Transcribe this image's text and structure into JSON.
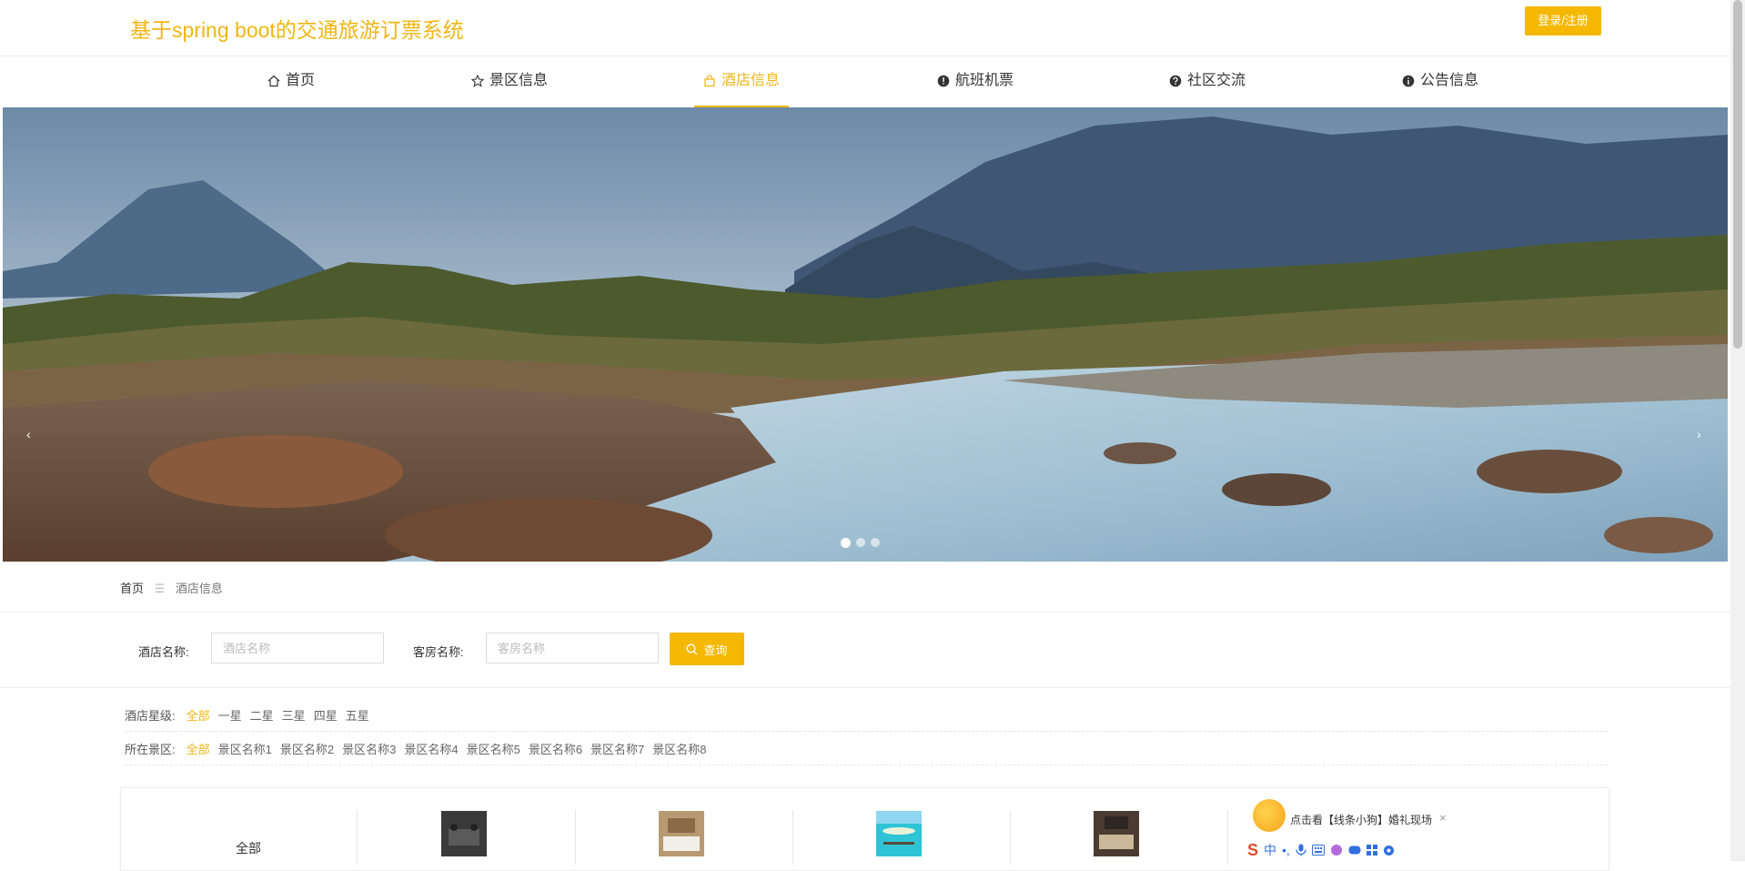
{
  "header": {
    "title": "基于spring boot的交通旅游订票系统",
    "login_label": "登录/注册"
  },
  "nav": {
    "items": [
      {
        "label": "首页",
        "icon": "home-icon"
      },
      {
        "label": "景区信息",
        "icon": "star-icon"
      },
      {
        "label": "酒店信息",
        "icon": "bag-icon"
      },
      {
        "label": "航班机票",
        "icon": "alert-icon"
      },
      {
        "label": "社区交流",
        "icon": "question-icon"
      },
      {
        "label": "公告信息",
        "icon": "info-icon"
      }
    ],
    "active_index": 2
  },
  "banner": {
    "slide_count": 3,
    "active_slide": 1,
    "prev_glyph": "‹",
    "next_glyph": "›"
  },
  "breadcrumb": {
    "home": "首页",
    "separator": "☰",
    "current": "酒店信息"
  },
  "search": {
    "hotel_label": "酒店名称:",
    "hotel_placeholder": "酒店名称",
    "room_label": "客房名称:",
    "room_placeholder": "客房名称",
    "button_label": "查询"
  },
  "filters": {
    "star": {
      "label": "酒店星级:",
      "options": [
        "全部",
        "一星",
        "二星",
        "三星",
        "四星",
        "五星"
      ],
      "selected": "全部"
    },
    "area": {
      "label": "所在景区:",
      "options": [
        "全部",
        "景区名称1",
        "景区名称2",
        "景区名称3",
        "景区名称4",
        "景区名称5",
        "景区名称6",
        "景区名称7",
        "景区名称8"
      ],
      "selected": "全部"
    }
  },
  "cards": {
    "first_label": "全部"
  },
  "ad": {
    "text": "点击看【线条小狗】婚礼现场",
    "close": "×"
  },
  "ime": {
    "logo": "S",
    "mode": "中",
    "punct": "•,"
  },
  "colors": {
    "accent": "#f0b613",
    "button": "#f5b800"
  }
}
